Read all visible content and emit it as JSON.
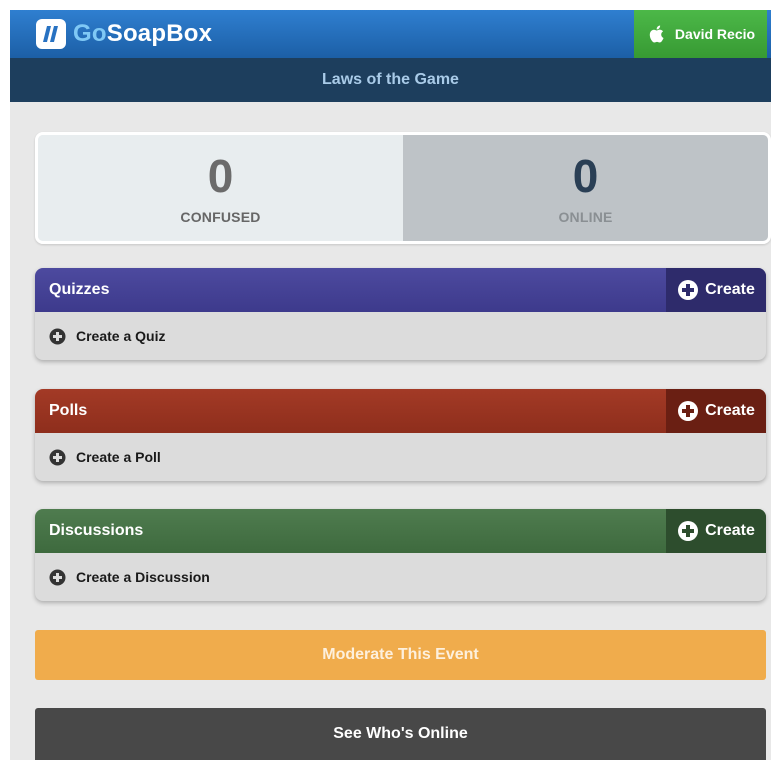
{
  "brand": {
    "name_prefix": "Go",
    "name_suffix": "SoapBox"
  },
  "user": {
    "name": "David Recio"
  },
  "event": {
    "title": "Laws of the Game"
  },
  "stats": {
    "confused": {
      "value": "0",
      "label": "CONFUSED"
    },
    "online": {
      "value": "0",
      "label": "ONLINE"
    }
  },
  "sections": {
    "quizzes": {
      "title": "Quizzes",
      "create_label": "Create",
      "row_label": "Create a Quiz",
      "color": "#46439a"
    },
    "polls": {
      "title": "Polls",
      "create_label": "Create",
      "row_label": "Create a Poll",
      "color": "#9b3522"
    },
    "discussions": {
      "title": "Discussions",
      "create_label": "Create",
      "row_label": "Create a Discussion",
      "color": "#487448"
    }
  },
  "actions": {
    "moderate_label": "Moderate This Event",
    "see_online_label": "See Who's Online"
  },
  "colors": {
    "topbar": "#2872c2",
    "subheader": "#1d3e5d",
    "user_button": "#42ad3e",
    "moderate": "#f0ac4c",
    "see_online": "#484848"
  },
  "icons": {
    "logo": "gosoapbox-logo-icon",
    "user": "apple-icon",
    "create": "plus-circle-icon"
  }
}
